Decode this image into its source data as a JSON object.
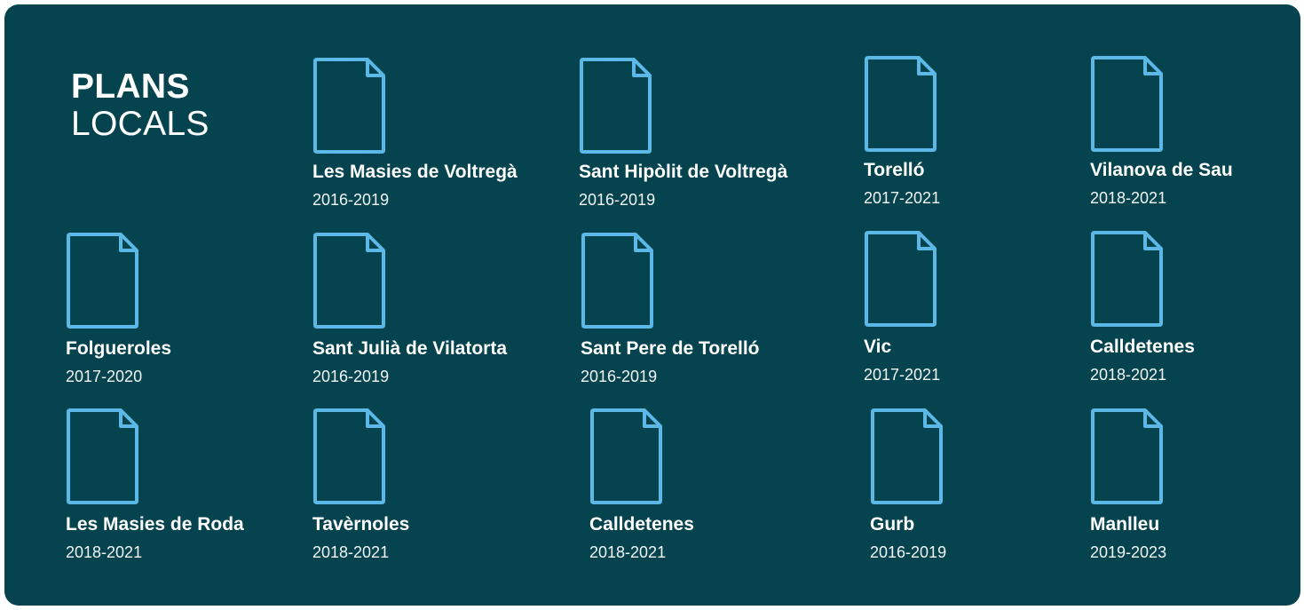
{
  "title": {
    "line1": "PLANS",
    "line2": "LOCALS"
  },
  "icon": "document-icon",
  "icon_color": "#5cb8e6",
  "background_color": "#05434f",
  "plans": [
    {
      "name": "Les Masies de Voltregà",
      "years": "2016-2019"
    },
    {
      "name": "Sant Hipòlit de Voltregà",
      "years": "2016-2019"
    },
    {
      "name": "Torelló",
      "years": "2017-2021"
    },
    {
      "name": "Vilanova de Sau",
      "years": "2018-2021"
    },
    {
      "name": "Folgueroles",
      "years": "2017-2020"
    },
    {
      "name": "Sant Julià de Vilatorta",
      "years": "2016-2019"
    },
    {
      "name": "Sant Pere de Torelló",
      "years": "2016-2019"
    },
    {
      "name": "Vic",
      "years": "2017-2021"
    },
    {
      "name": "Calldetenes",
      "years": "2018-2021"
    },
    {
      "name": "Les Masies de Roda",
      "years": "2018-2021"
    },
    {
      "name": "Tavèrnoles",
      "years": "2018-2021"
    },
    {
      "name": "Calldetenes",
      "years": "2018-2021"
    },
    {
      "name": "Gurb",
      "years": "2016-2019"
    },
    {
      "name": "Manlleu",
      "years": "2019-2023"
    }
  ]
}
